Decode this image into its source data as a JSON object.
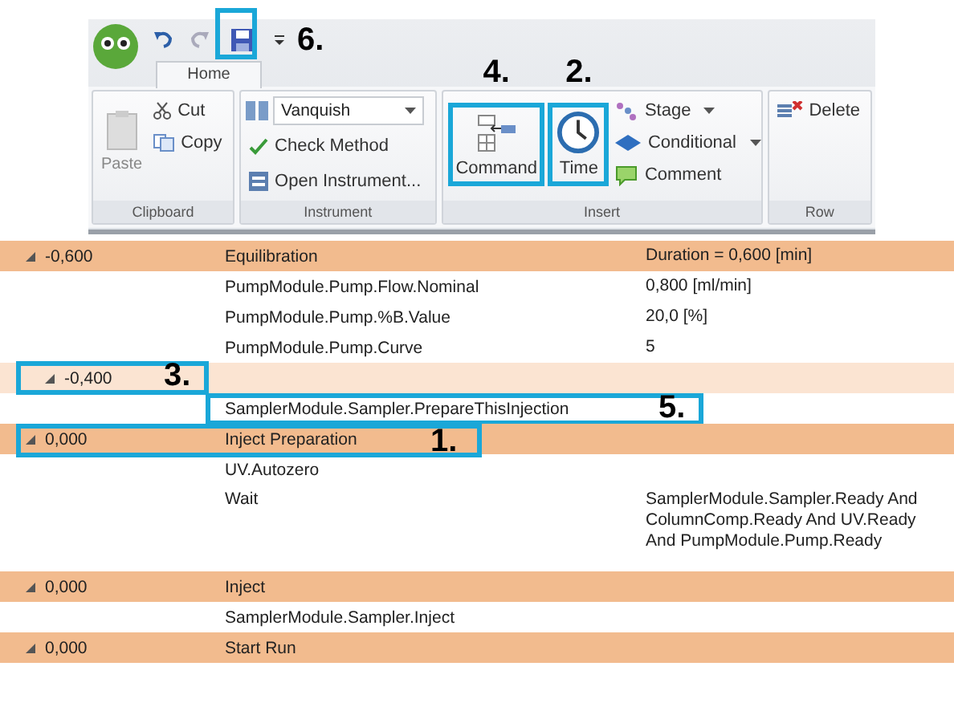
{
  "quick_access": {
    "save_callout": "6."
  },
  "ribbon": {
    "tab": {
      "label": "Home",
      "selected": true
    },
    "groups": [
      {
        "kind": "clipboard",
        "label": "Clipboard",
        "paste": "Paste",
        "cut": "Cut",
        "copy": "Copy"
      },
      {
        "kind": "instrument",
        "label": "Instrument",
        "dropdown": "Vanquish",
        "check": "Check Method",
        "open": "Open Instrument..."
      },
      {
        "kind": "insert",
        "label": "Insert",
        "command": "Command",
        "command_callout": "4.",
        "time": "Time",
        "time_callout": "2.",
        "stage": "Stage",
        "conditional": "Conditional",
        "comment": "Comment"
      },
      {
        "kind": "row",
        "label": "Row",
        "delete": "Delete"
      }
    ]
  },
  "rows": [
    {
      "kind": "group",
      "time": "-0,600",
      "action": "Equilibration",
      "value": [
        "Duration = 0,600 [min]"
      ]
    },
    {
      "kind": "step",
      "action": "PumpModule.Pump.Flow.Nominal",
      "value": [
        "0,800 [ml/min]"
      ]
    },
    {
      "kind": "step",
      "action": "PumpModule.Pump.%B.Value",
      "value": [
        "20,0 [%]"
      ]
    },
    {
      "kind": "step",
      "action": "PumpModule.Pump.Curve",
      "value": [
        "5"
      ]
    },
    {
      "kind": "subgroup",
      "time": "-0,400",
      "callout": "3."
    },
    {
      "kind": "step",
      "action": "SamplerModule.Sampler.PrepareThisInjection",
      "callout": "5."
    },
    {
      "kind": "group",
      "time": "0,000",
      "action": "Inject Preparation",
      "callout": "1."
    },
    {
      "kind": "step",
      "action": "UV.Autozero"
    },
    {
      "kind": "step",
      "action": "Wait",
      "value": [
        "SamplerModule.Sampler.Ready And",
        "ColumnComp.Ready And UV.Ready",
        "And PumpModule.Pump.Ready"
      ]
    },
    {
      "kind": "group",
      "time": "0,000",
      "action": "Inject"
    },
    {
      "kind": "step",
      "action": "SamplerModule.Sampler.Inject"
    },
    {
      "kind": "group",
      "time": "0,000",
      "action": "Start Run"
    }
  ]
}
